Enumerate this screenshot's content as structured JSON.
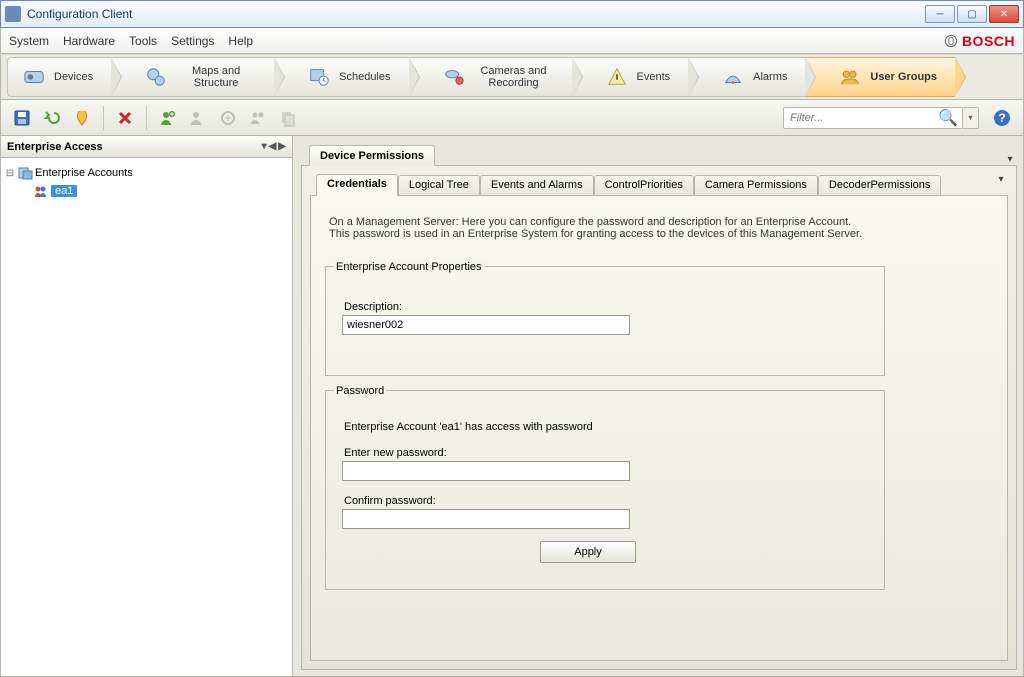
{
  "window": {
    "title": "Configuration Client"
  },
  "menu": {
    "system": "System",
    "hardware": "Hardware",
    "tools": "Tools",
    "settings": "Settings",
    "help": "Help"
  },
  "brand": {
    "name": "BOSCH"
  },
  "steps": {
    "devices": "Devices",
    "maps": "Maps and Structure",
    "schedules": "Schedules",
    "cameras": "Cameras and Recording",
    "events": "Events",
    "alarms": "Alarms",
    "usergroups": "User Groups"
  },
  "toolbar": {
    "filter_placeholder": "Filter..."
  },
  "left": {
    "title": "Enterprise Access",
    "root": "Enterprise Accounts",
    "item1": "ea1"
  },
  "right": {
    "tab_main": "Device Permissions",
    "tabs": {
      "credentials": "Credentials",
      "logical": "Logical Tree",
      "events": "Events and Alarms",
      "control": "ControlPriorities",
      "camera": "Camera Permissions",
      "decoder": "DecoderPermissions"
    },
    "info_line1": "On a Management Server: Here you can configure the password and description for an Enterprise Account.",
    "info_line2": "This password is used in an Enterprise System for granting access to the devices of this Management Server.",
    "group1_title": "Enterprise Account Properties",
    "description_label": "Description:",
    "description_value": "wiesner002",
    "group2_title": "Password",
    "pw_statement": "Enterprise Account 'ea1' has access with password",
    "pw_new_label": "Enter new password:",
    "pw_confirm_label": "Confirm password:",
    "apply": "Apply"
  }
}
